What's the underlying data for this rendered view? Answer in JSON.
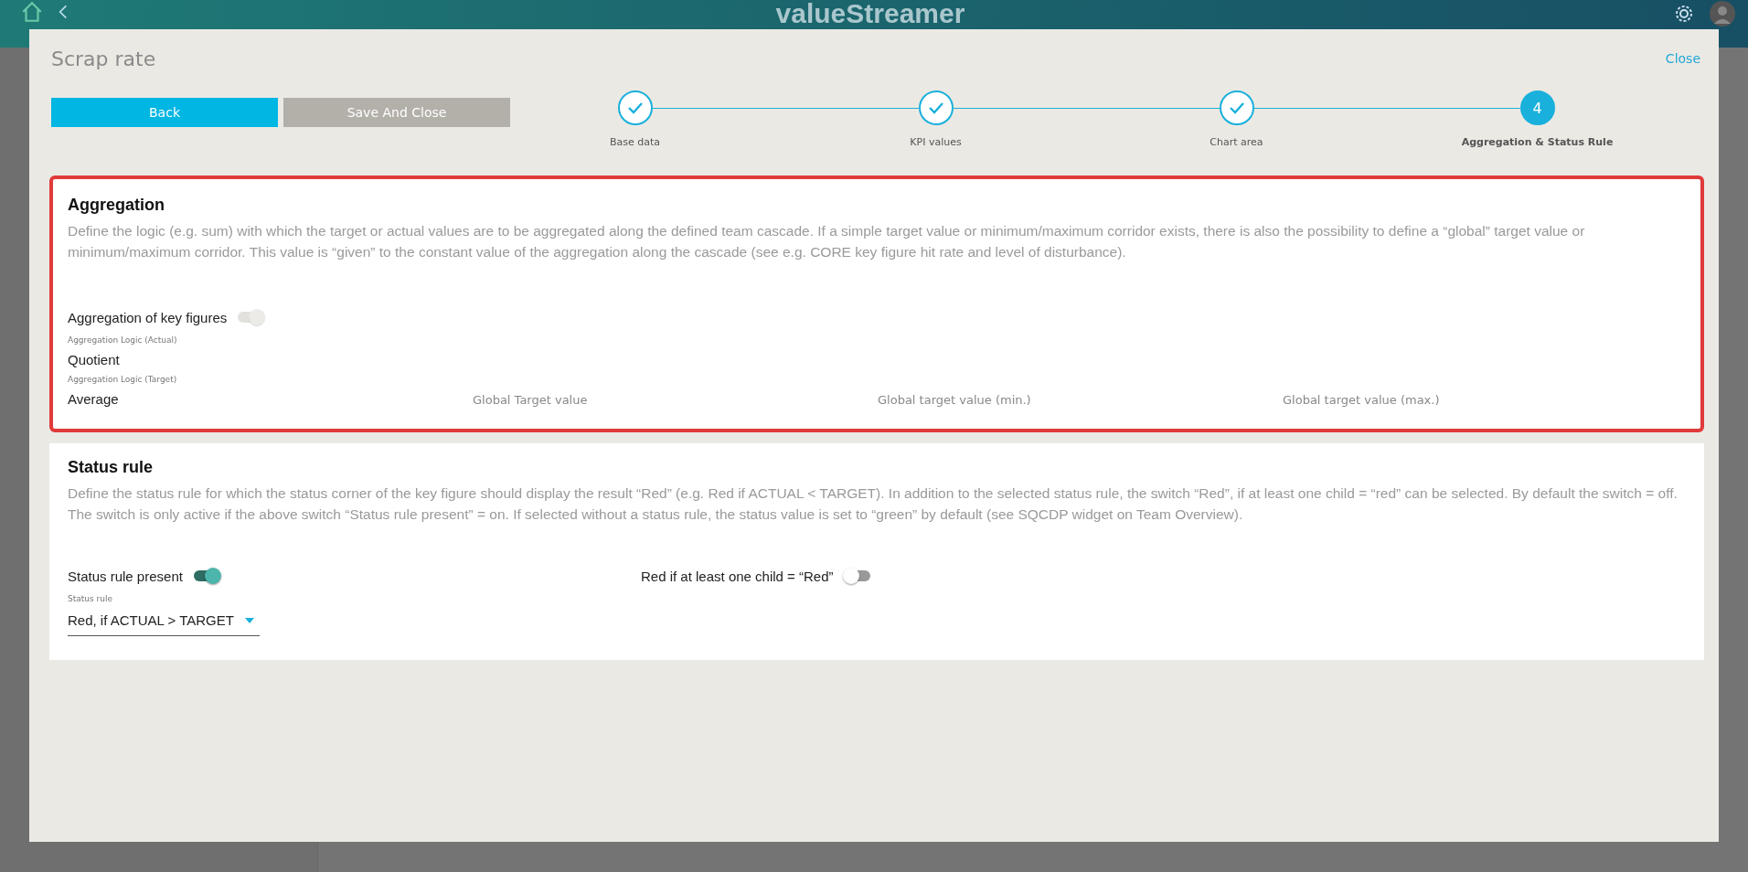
{
  "app_bar": {
    "logo": "valueStreamer"
  },
  "dialog": {
    "title": "Scrap rate",
    "close": "Close",
    "buttons": [
      {
        "label": "Back",
        "disabled": false
      },
      {
        "label": "Save And Close",
        "disabled": true
      }
    ],
    "steps": [
      {
        "label": "Base data",
        "completed": true,
        "selected": false
      },
      {
        "label": "KPI values",
        "completed": true,
        "selected": false
      },
      {
        "label": "Chart area",
        "completed": true,
        "selected": false
      },
      {
        "label": "Aggregation & Status Rule",
        "number": "4",
        "completed": false,
        "selected": true
      }
    ],
    "aggregation": {
      "title": "Aggregation",
      "highlighted": true,
      "description": "Define the logic (e.g. sum) with which the target or actual values are to be aggregated along the defined team cascade. If a simple target value or minimum/maximum corridor exists, there is also the possibility to define a “global” target value or minimum/maximum corridor. This value is “given” to the constant value of the aggregation along the cascade (see e.g. CORE key figure hit rate and level of disturbance).",
      "switch": {
        "label": "Aggregation of key figures",
        "on": true,
        "disabled": true
      },
      "actual": {
        "label": "Aggregation Logic (Actual)",
        "value": "Quotient"
      },
      "target": {
        "label": "Aggregation Logic (Target)",
        "value": "Average"
      },
      "global_fields": [
        {
          "placeholder": "Global Target value"
        },
        {
          "placeholder": "Global target value (min.)"
        },
        {
          "placeholder": "Global target value (max.)"
        }
      ]
    },
    "status_rule": {
      "title": "Status rule",
      "highlighted": false,
      "description": "Define the status rule for which the status corner of the key figure should display the result “Red” (e.g. Red if ACTUAL < TARGET). In addition to the selected status rule, the switch “Red”, if at least one child = “red” can be selected. By default the switch = off. The switch is only active if the above switch “Status rule present” = on. If selected without a status rule, the status value is set to “green” by default (see SQCDP widget on Team Overview).",
      "switch": {
        "label": "Status rule present",
        "on": true,
        "disabled": false
      },
      "red_switch": {
        "label": "Red if at least one child = “Red”",
        "on": false,
        "disabled": false
      },
      "select": {
        "label": "Status rule",
        "value": "Red, if ACTUAL > TARGET"
      }
    }
  }
}
